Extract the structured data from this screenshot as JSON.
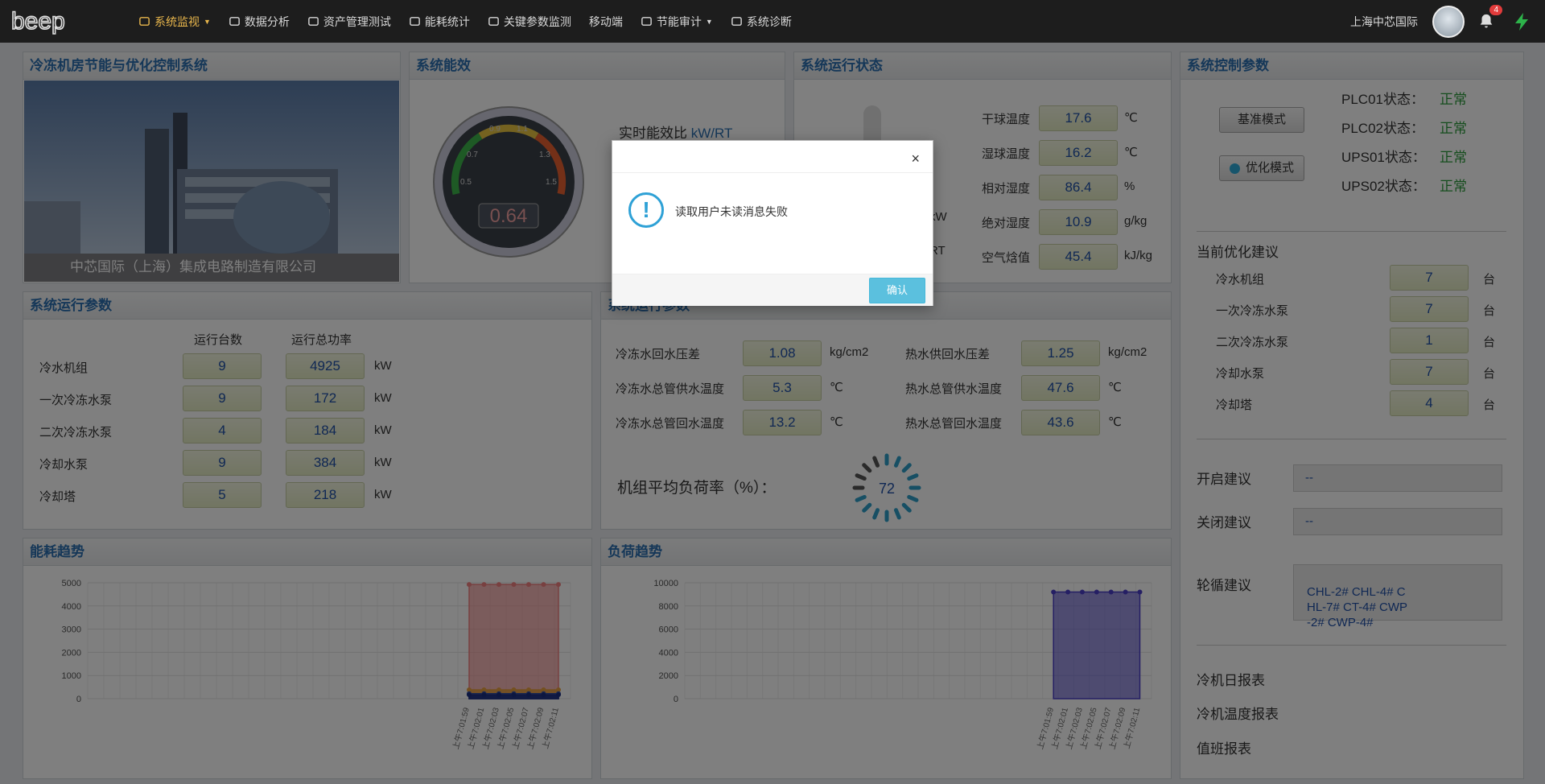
{
  "nav": {
    "items": [
      {
        "label": "系统监视",
        "icon": "dashboard-icon",
        "caret": true,
        "active": true
      },
      {
        "label": "数据分析",
        "icon": "analysis-icon",
        "caret": false,
        "active": false
      },
      {
        "label": "资产管理测试",
        "icon": "asset-icon",
        "caret": false,
        "active": false
      },
      {
        "label": "能耗统计",
        "icon": "gauge-icon",
        "caret": false,
        "active": false
      },
      {
        "label": "关键参数监测",
        "icon": "list-icon",
        "caret": false,
        "active": false
      },
      {
        "label": "移动端",
        "icon": "",
        "caret": false,
        "active": false
      },
      {
        "label": "节能审计",
        "icon": "layers-icon",
        "caret": true,
        "active": false
      },
      {
        "label": "系统诊断",
        "icon": "info-icon",
        "caret": false,
        "active": false
      }
    ],
    "company": "上海中芯国际",
    "notification_count": "4"
  },
  "panels": {
    "photo": {
      "title": "冷冻机房节能与优化控制系统",
      "caption": "中芯国际（上海）集成电路制造有限公司"
    },
    "efficiency": {
      "title": "系统能效",
      "value": "0.64",
      "label": "实时能效比",
      "unit": "kW/RT",
      "ticks": [
        "0.5",
        "0.7",
        "0.9",
        "1.1",
        "1.3",
        "1.5"
      ]
    },
    "status": {
      "title": "系统运行状态",
      "rows": [
        {
          "label": "干球温度",
          "value": "17.6",
          "unit": "℃"
        },
        {
          "label": "湿球温度",
          "value": "16.2",
          "unit": "℃"
        },
        {
          "label": "相对湿度",
          "value": "86.4",
          "unit": "%"
        },
        {
          "label": "绝对湿度",
          "value": "10.9",
          "unit": "g/kg"
        },
        {
          "label": "空气焓值",
          "value": "45.4",
          "unit": "kJ/kg"
        }
      ],
      "partial_units": [
        "kW",
        "RT"
      ]
    },
    "control": {
      "title": "系统控制参数",
      "mode_buttons": [
        "基准模式",
        "优化模式"
      ],
      "plc": [
        {
          "label": "PLC01状态：",
          "value": "正常"
        },
        {
          "label": "PLC02状态：",
          "value": "正常"
        },
        {
          "label": "UPS01状态：",
          "value": "正常"
        },
        {
          "label": "UPS02状态：",
          "value": "正常"
        }
      ],
      "advice_title": "当前优化建议",
      "advice": [
        {
          "label": "冷水机组",
          "value": "7",
          "unit": "台"
        },
        {
          "label": "一次冷冻水泵",
          "value": "7",
          "unit": "台"
        },
        {
          "label": "二次冷冻水泵",
          "value": "1",
          "unit": "台"
        },
        {
          "label": "冷却水泵",
          "value": "7",
          "unit": "台"
        },
        {
          "label": "冷却塔",
          "value": "4",
          "unit": "台"
        }
      ],
      "open_label": "开启建议",
      "open_value": "--",
      "close_label": "关闭建议",
      "close_value": "--",
      "rotate_label": "轮循建议",
      "rotate_lines": [
        "CHL-2# CHL-4# C",
        "HL-7# CT-4# CWP",
        "-2# CWP-4#"
      ],
      "reports": [
        "冷机日报表",
        "冷机温度报表",
        "值班报表"
      ]
    },
    "run_params": {
      "title": "系统运行参数",
      "col1": "运行台数",
      "col2": "运行总功率",
      "rows": [
        {
          "label": "冷水机组",
          "count": "9",
          "power": "4925",
          "unit": "kW"
        },
        {
          "label": "一次冷冻水泵",
          "count": "9",
          "power": "172",
          "unit": "kW"
        },
        {
          "label": "二次冷冻水泵",
          "count": "4",
          "power": "184",
          "unit": "kW"
        },
        {
          "label": "冷却水泵",
          "count": "9",
          "power": "384",
          "unit": "kW"
        },
        {
          "label": "冷却塔",
          "count": "5",
          "power": "218",
          "unit": "kW"
        }
      ]
    },
    "water": {
      "title": "系统运行参数",
      "left": [
        {
          "label": "冷冻水回水压差",
          "value": "1.08",
          "unit": "kg/cm2"
        },
        {
          "label": "冷冻水总管供水温度",
          "value": "5.3",
          "unit": "℃"
        },
        {
          "label": "冷冻水总管回水温度",
          "value": "13.2",
          "unit": "℃"
        }
      ],
      "right": [
        {
          "label": "热水供回水压差",
          "value": "1.25",
          "unit": "kg/cm2"
        },
        {
          "label": "热水总管供水温度",
          "value": "47.6",
          "unit": "℃"
        },
        {
          "label": "热水总管回水温度",
          "value": "43.6",
          "unit": "℃"
        }
      ],
      "load_label": "机组平均负荷率（%）：",
      "load_value": "72"
    },
    "energy_trend": {
      "title": "能耗趋势"
    },
    "load_trend": {
      "title": "负荷趋势"
    }
  },
  "chart_data": [
    {
      "type": "area",
      "title": "能耗趋势",
      "x": [
        "上午7:01:59",
        "上午7:02:01",
        "上午7:02:03",
        "上午7:02:05",
        "上午7:02:07",
        "上午7:02:09",
        "上午7:02:11"
      ],
      "ylim": [
        0,
        5000
      ],
      "yticks": [
        "0",
        "1000",
        "2000",
        "3000",
        "4000",
        "5000"
      ],
      "series": [
        {
          "values": [
            4925,
            4925,
            4925,
            4925,
            4925,
            4925,
            4925
          ],
          "color": "#f08080"
        },
        {
          "values": [
            384,
            384,
            384,
            384,
            384,
            384,
            384
          ],
          "color": "#e8a040"
        },
        {
          "values": [
            218,
            218,
            218,
            218,
            218,
            218,
            218
          ],
          "color": "#2f4fa0"
        },
        {
          "values": [
            184,
            184,
            184,
            184,
            184,
            184,
            184
          ],
          "color": "#7a7ad0"
        },
        {
          "values": [
            172,
            172,
            172,
            172,
            172,
            172,
            172
          ],
          "color": "#1a2f80"
        }
      ]
    },
    {
      "type": "area",
      "title": "负荷趋势",
      "x": [
        "上午7:01:59",
        "上午7:02:01",
        "上午7:02:03",
        "上午7:02:05",
        "上午7:02:07",
        "上午7:02:09",
        "上午7:02:11"
      ],
      "ylim": [
        0,
        10000
      ],
      "yticks": [
        "0",
        "2000",
        "4000",
        "6000",
        "8000",
        "10000"
      ],
      "series": [
        {
          "values": [
            9200,
            9200,
            9200,
            9200,
            9200,
            9200,
            9200
          ],
          "color": "#4a3fc8"
        }
      ]
    }
  ],
  "modal": {
    "message": "读取用户未读消息失败",
    "ok": "确认",
    "close": "×"
  }
}
